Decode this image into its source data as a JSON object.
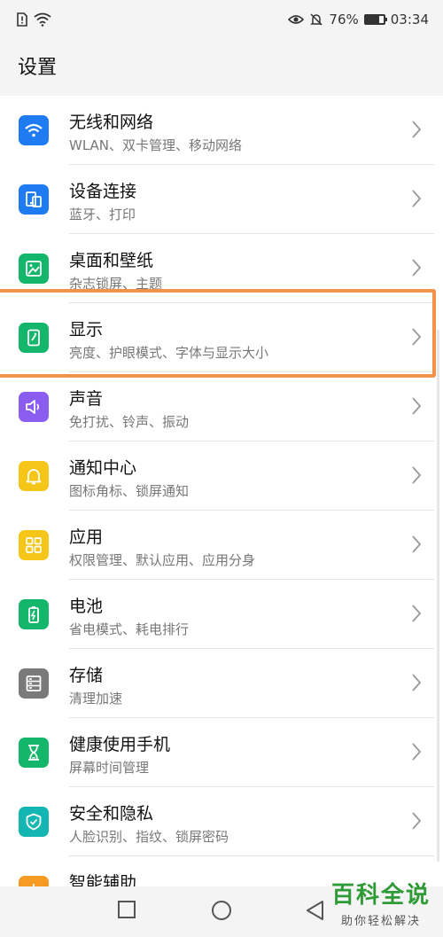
{
  "status_bar": {
    "battery_percent": "76%",
    "battery_level": 0.76,
    "time": "03:34",
    "icons": [
      "sim-alert-icon",
      "wifi-icon",
      "eye-comfort-icon",
      "mute-bell-icon",
      "battery-icon"
    ]
  },
  "page": {
    "title": "设置"
  },
  "settings": [
    {
      "title": "无线和网络",
      "subtitle": "WLAN、双卡管理、移动网络",
      "icon": "wifi-icon",
      "color": "#1e7bf2"
    },
    {
      "title": "设备连接",
      "subtitle": "蓝牙、打印",
      "icon": "device-connect-icon",
      "color": "#1e7bf2"
    },
    {
      "title": "桌面和壁纸",
      "subtitle": "杂志锁屏、主题",
      "icon": "wallpaper-icon",
      "color": "#13b66a"
    },
    {
      "title": "显示",
      "subtitle": "亮度、护眼模式、字体与显示大小",
      "icon": "display-icon",
      "color": "#13b66a"
    },
    {
      "title": "声音",
      "subtitle": "免打扰、铃声、振动",
      "icon": "speaker-icon",
      "color": "#8b5cf0"
    },
    {
      "title": "通知中心",
      "subtitle": "图标角标、锁屏通知",
      "icon": "bell-icon",
      "color": "#f5c518"
    },
    {
      "title": "应用",
      "subtitle": "权限管理、默认应用、应用分身",
      "icon": "apps-grid-icon",
      "color": "#f5c518"
    },
    {
      "title": "电池",
      "subtitle": "省电模式、耗电排行",
      "icon": "battery-icon",
      "color": "#13b66a"
    },
    {
      "title": "存储",
      "subtitle": "清理加速",
      "icon": "storage-icon",
      "color": "#7a7a7a"
    },
    {
      "title": "健康使用手机",
      "subtitle": "屏幕时间管理",
      "icon": "hourglass-icon",
      "color": "#13b66a"
    },
    {
      "title": "安全和隐私",
      "subtitle": "人脸识别、指纹、锁屏密码",
      "icon": "shield-icon",
      "color": "#13b6b0"
    },
    {
      "title": "智能辅助",
      "subtitle": "",
      "icon": "smart-assist-icon",
      "color": "#f59a23"
    }
  ],
  "watermark": {
    "title": "百科全说",
    "subtitle": "助你轻松解决"
  },
  "nav": {
    "icons": [
      "recent-apps-icon",
      "home-icon",
      "back-icon"
    ]
  }
}
